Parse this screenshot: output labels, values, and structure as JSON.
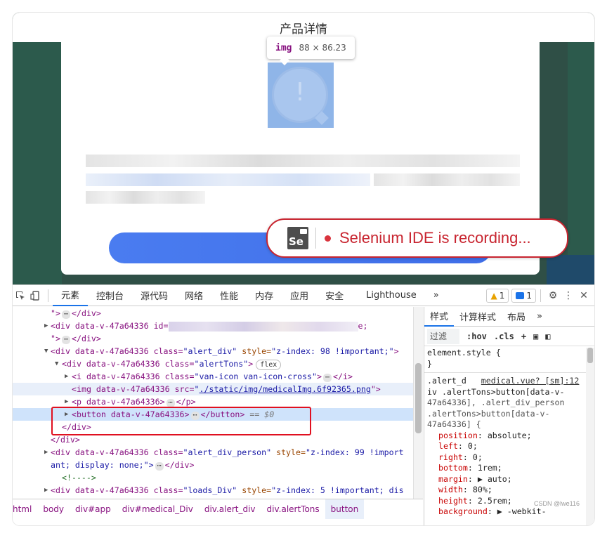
{
  "page": {
    "title": "产品详情",
    "tooltip": {
      "tag": "img",
      "dims": "88 × 86.23"
    },
    "selenium_banner": {
      "logo": "Se",
      "message": "Selenium IDE is recording..."
    }
  },
  "devtools": {
    "tabs": [
      "元素",
      "控制台",
      "源代码",
      "网络",
      "性能",
      "内存",
      "应用",
      "安全",
      "Lighthouse"
    ],
    "more": "»",
    "warnings": "1",
    "messages": "1",
    "dom": [
      {
        "text": "\">",
        "tail": "</div>"
      },
      {
        "open": "<div data-v-47a64336 id=",
        "blurred": true,
        "end": "e;",
        "next": "\">",
        "close": "</div>"
      },
      {
        "open": "<div data-v-47a64336 class=",
        "val": "\"alert_div\"",
        "attr": " style=",
        "val2": "\"z-index: 98 !important;\"",
        "end": ">"
      },
      {
        "open": "<div data-v-47a64336 class=",
        "val": "\"alertTons\"",
        "end": ">",
        "badge": "flex"
      },
      {
        "open": "<i data-v-47a64336 class=",
        "val": "\"van-icon van-icon-cross\"",
        "end": ">",
        "close": "</i>"
      },
      {
        "open": "<img data-v-47a64336 src=",
        "link": "./static/img/medicalImg.6f92365.png",
        "end": "\">"
      },
      {
        "open": "<p data-v-47a64336>",
        "close": "</p>"
      },
      {
        "open": "<button data-v-47a64336>",
        "close": "</button>",
        "eq": " == $0"
      },
      {
        "close": "</div>"
      },
      {
        "close": "</div>"
      },
      {
        "open": "<div data-v-47a64336 class=",
        "val": "\"alert_div_person\"",
        "attr": " style=",
        "val2": "\"z-index: 99 !import",
        "wrap": "ant; display: none;\">",
        "close": "</div>"
      },
      {
        "comment": "<!---->"
      },
      {
        "open": "<div data-v-47a64336 class=",
        "val": "\"loads_Div\"",
        "attr": " style=",
        "val2": "\"z-index: 5 !important; dis"
      }
    ],
    "breadcrumbs": [
      "html",
      "body",
      "div#app",
      "div#medical_Div",
      "div.alert_div",
      "div.alertTons",
      "button"
    ],
    "styles": {
      "tabs": [
        "样式",
        "计算样式",
        "布局"
      ],
      "more": "»",
      "filter_placeholder": "过滤",
      "hov": ":hov",
      "cls": ".cls",
      "element_style": "element.style {",
      "element_close": "}",
      "rule_sel1": ".alert_d",
      "rule_src": "medical.vue? [sm]:12",
      "rule_sel2": "iv .alertTons>button[data-v-",
      "rule_sel3": "47a64336], .alert_div_person",
      "rule_sel4": ".alertTons>button[data-v-",
      "rule_sel5": "47a64336] {",
      "props": [
        {
          "name": "position",
          "value": "absolute;"
        },
        {
          "name": "left",
          "value": "0;"
        },
        {
          "name": "right",
          "value": "0;"
        },
        {
          "name": "bottom",
          "value": "1rem;"
        },
        {
          "name": "margin",
          "value": "▶ auto;"
        },
        {
          "name": "width",
          "value": "80%;"
        },
        {
          "name": "height",
          "value": "2.5rem;"
        },
        {
          "name": "background",
          "value": "▶ -webkit-"
        }
      ]
    }
  },
  "watermark": "CSDN @lwe116"
}
